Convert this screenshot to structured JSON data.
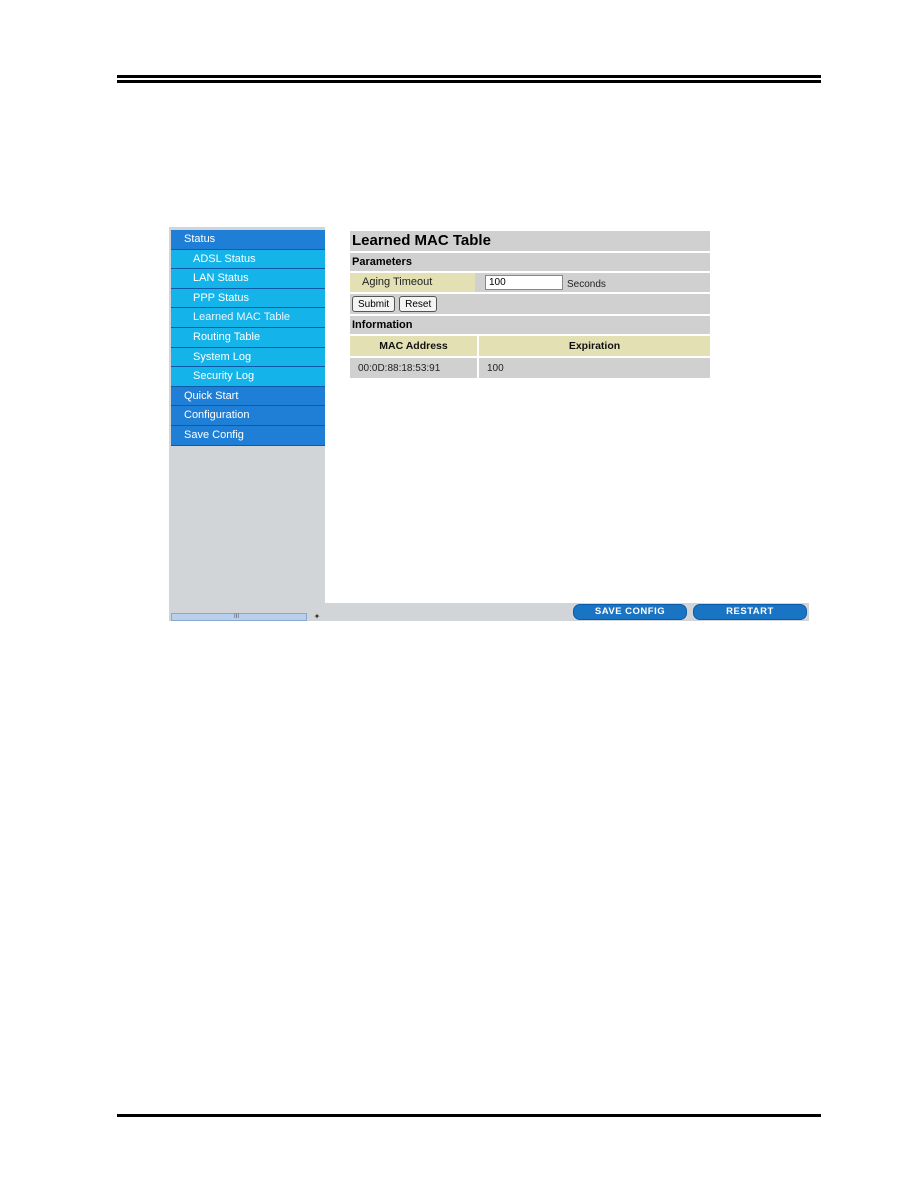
{
  "sidebar": {
    "items": [
      {
        "label": "Status",
        "level": "main"
      },
      {
        "label": "ADSL Status",
        "level": "sub"
      },
      {
        "label": "LAN Status",
        "level": "sub"
      },
      {
        "label": "PPP Status",
        "level": "sub"
      },
      {
        "label": "Learned MAC Table",
        "level": "sub",
        "active": true
      },
      {
        "label": "Routing Table",
        "level": "sub"
      },
      {
        "label": "System Log",
        "level": "sub"
      },
      {
        "label": "Security Log",
        "level": "sub"
      },
      {
        "label": "Quick Start",
        "level": "main"
      },
      {
        "label": "Configuration",
        "level": "main"
      },
      {
        "label": "Save Config",
        "level": "main"
      }
    ],
    "scroll_thumb": "III",
    "tool_icon": "✦"
  },
  "main": {
    "title": "Learned MAC Table",
    "parameters_heading": "Parameters",
    "aging_timeout_label": "Aging Timeout",
    "aging_timeout_value": "100",
    "aging_timeout_unit": "Seconds",
    "submit_label": "Submit",
    "reset_label": "Reset",
    "information_heading": "Information",
    "table": {
      "columns": [
        "MAC Address",
        "Expiration"
      ],
      "rows": [
        [
          "00:0D:88:18:53:91",
          "100"
        ]
      ]
    }
  },
  "footer": {
    "save_config_label": "SAVE CONFIG",
    "restart_label": "RESTART"
  },
  "colors": {
    "nav_main": "#1f7fd6",
    "nav_sub": "#14b4ea",
    "label_bg": "#e3e0b4",
    "row_bg": "#d0d0d0",
    "footer_button": "#1a74c4"
  }
}
